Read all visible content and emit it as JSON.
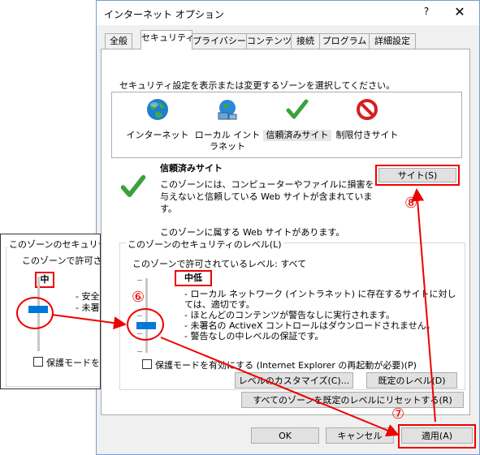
{
  "dialog": {
    "title": "インターネット オプション",
    "help": "?",
    "close": "✕",
    "tabs": [
      "全般",
      "セキュリティ",
      "プライバシー",
      "コンテンツ",
      "接続",
      "プログラム",
      "詳細設定"
    ],
    "active_tab": "セキュリティ"
  },
  "security": {
    "zone_prompt": "セキュリティ設定を表示または変更するゾーンを選択してください。",
    "zones": [
      {
        "label": "インターネット",
        "icon": "globe-icon"
      },
      {
        "label": "ローカル イントラネット",
        "icon": "intranet-icon"
      },
      {
        "label": "信頼済みサイト",
        "icon": "checkmark-icon"
      },
      {
        "label": "制限付きサイト",
        "icon": "no-entry-icon"
      }
    ],
    "selected_zone": "信頼済みサイト",
    "zone_title": "信頼済みサイト",
    "zone_desc": "このゾーンには、コンピューターやファイルに損害を与えないと信頼している Web サイトが含まれています。",
    "sites_button": "サイト(S)",
    "has_sites": "このゾーンに属する Web サイトがあります。",
    "level_group": "このゾーンのセキュリティのレベル(L)",
    "allowed_levels": "このゾーンで許可されているレベル: すべて",
    "level_name": "中低",
    "level_desc": [
      "- ローカル ネットワーク (イントラネット) に存在するサイトに対しては、適切です。",
      "- ほとんどのコンテンツが警告なしに実行されます。",
      "- 未署名の ActiveX コントロールはダウンロードされません。",
      "- 警告なしの中レベルの保証です。"
    ],
    "protected_mode": "保護モードを有効にする (Internet Explorer の再起動が必要)(P)",
    "custom_level": "レベルのカスタマイズ(C)...",
    "default_level": "既定のレベル(D)",
    "reset_all": "すべてのゾーンを既定のレベルにリセットする(R)"
  },
  "footer": {
    "ok": "OK",
    "cancel": "キャンセル",
    "apply": "適用(A)"
  },
  "inset": {
    "group": "このゾーンのセキュリティのレベル",
    "allowed": "このゾーンで許可されているレベル",
    "level_name": "中",
    "line1": "- 安全",
    "line2": "- 未署",
    "protect": "保護モードを有効にする"
  },
  "annotations": {
    "step6": "⑥",
    "step7": "⑦",
    "step8": "⑧",
    "color": "#e00000"
  }
}
